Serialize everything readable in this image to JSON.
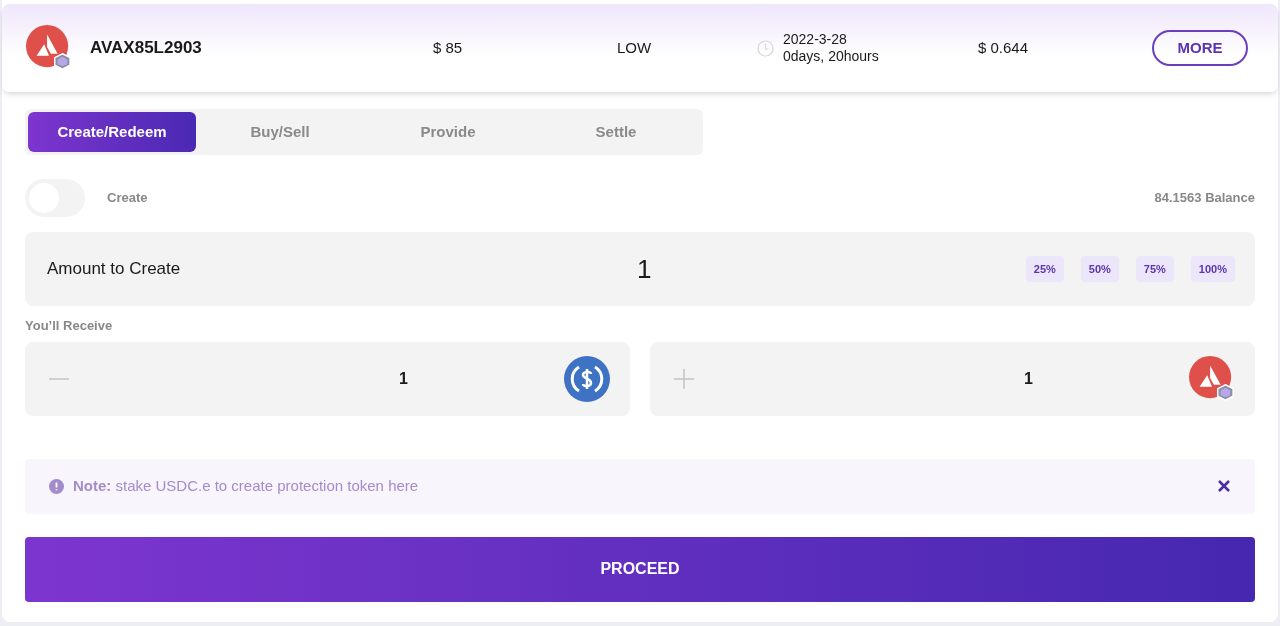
{
  "header": {
    "symbol": "AVAX85L2903",
    "strike": "$ 85",
    "risk": "LOW",
    "expiry_date": "2022-3-28",
    "expiry_remaining": "0days, 20hours",
    "price": "$ 0.644",
    "more_button": "MORE"
  },
  "tabs": [
    {
      "label": "Create/Redeem",
      "selected": true
    },
    {
      "label": "Buy/Sell",
      "selected": false
    },
    {
      "label": "Provide",
      "selected": false
    },
    {
      "label": "Settle",
      "selected": false
    }
  ],
  "toggle": {
    "label": "Create",
    "on": false
  },
  "balance": "84.1563 Balance",
  "amount": {
    "label": "Amount to Create",
    "value": "1",
    "presets": [
      "25%",
      "50%",
      "75%",
      "100%"
    ]
  },
  "receive": {
    "label": "You’ll Receive",
    "items": [
      {
        "kind": "pay",
        "value": "1"
      },
      {
        "kind": "get",
        "value": "1"
      }
    ]
  },
  "note": {
    "text": "**Note:** stake USDC.e to create protection token here"
  },
  "proceed_button": "PROCEED"
}
